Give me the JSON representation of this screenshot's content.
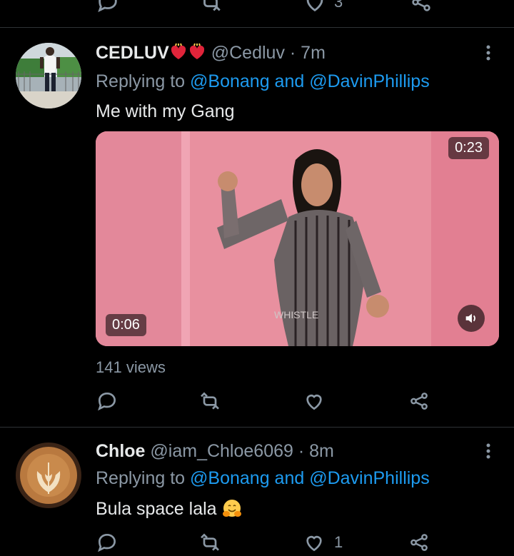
{
  "top_partial": {
    "like_count": "3"
  },
  "tweets": [
    {
      "name": "CEDLUV",
      "handle": "@Cedluv",
      "time": "· 7m",
      "replying_prefix": "Replying to",
      "replying_users": "@Bonang and @DavinPhillips",
      "text": "Me with my Gang",
      "media": {
        "duration": "0:23",
        "current_time": "0:06",
        "watermark": "WHISTLE"
      },
      "views": "141 views",
      "like_count": ""
    },
    {
      "name": "Chloe",
      "handle": "@iam_Chloe6069",
      "time": "· 8m",
      "replying_prefix": "Replying to",
      "replying_users": "@Bonang and @DavinPhillips",
      "text": "Bula space lala",
      "like_count": "1"
    }
  ],
  "icons": {
    "reply": "reply-icon",
    "retweet": "retweet-icon",
    "like": "heart-icon",
    "share": "share-icon",
    "more": "more-vertical-icon",
    "volume": "volume-icon"
  },
  "colors": {
    "link": "#1d9bf0",
    "muted": "#8b98a5",
    "background": "#000000"
  }
}
